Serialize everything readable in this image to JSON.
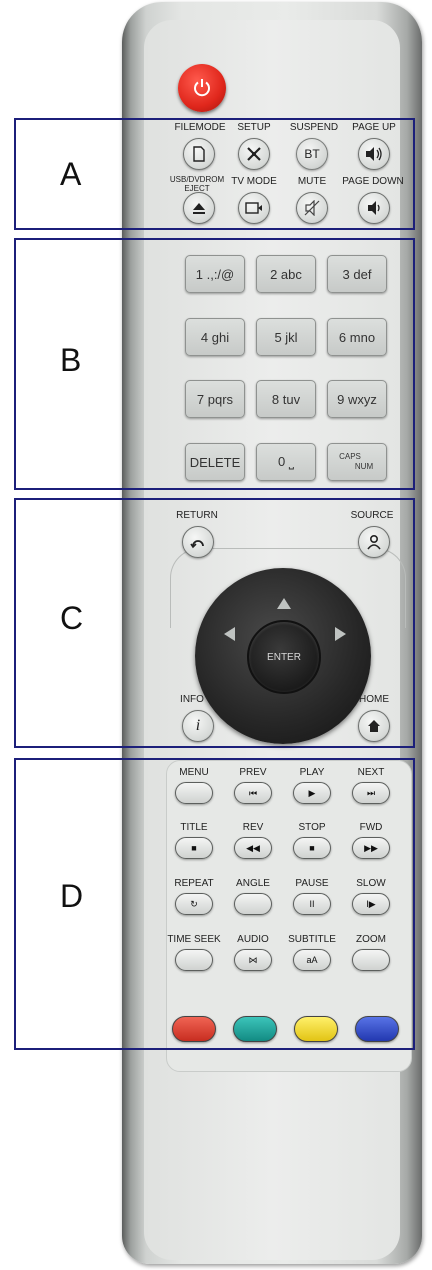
{
  "colors": {
    "frame": "#1c1f7a",
    "power_red": "#e0271c",
    "red_key": "#d93a2c",
    "green_key": "#19a39a",
    "yellow_key": "#f2d92a",
    "blue_key": "#2c49c7"
  },
  "sections": {
    "a": "A",
    "b": "B",
    "c": "C",
    "d": "D"
  },
  "power": {
    "icon": "power-icon"
  },
  "section_a": {
    "row1": [
      {
        "label": "FILEMODE",
        "icon": "file-icon"
      },
      {
        "label": "SETUP",
        "icon": "tools-icon"
      },
      {
        "label": "SUSPEND",
        "text": "BT"
      },
      {
        "label": "PAGE UP",
        "icon": "volume-up-icon"
      }
    ],
    "row2": [
      {
        "label": "USB/DVDROM EJECT",
        "icon": "eject-icon"
      },
      {
        "label": "TV MODE",
        "icon": "tv-mode-icon"
      },
      {
        "label": "MUTE",
        "icon": "mute-icon"
      },
      {
        "label": "PAGE DOWN",
        "icon": "volume-down-icon"
      }
    ]
  },
  "keypad": {
    "keys": [
      "1 .,:/@",
      "2 abc",
      "3 def",
      "4 ghi",
      "5 jkl",
      "6 mno",
      "7 pqrs",
      "8 tuv",
      "9 wxyz",
      "DELETE",
      "0 ⎵"
    ],
    "caps_top": "CAPS",
    "caps_bottom": "NUM"
  },
  "nav": {
    "return_label": "RETURN",
    "source_label": "SOURCE",
    "info_label": "INFO",
    "home_label": "HOME",
    "enter_label": "ENTER",
    "info_glyph": "i"
  },
  "playback": {
    "labels": [
      "MENU",
      "PREV",
      "PLAY",
      "NEXT",
      "TITLE",
      "REV",
      "STOP",
      "FWD",
      "REPEAT",
      "ANGLE",
      "PAUSE",
      "SLOW",
      "TIME SEEK",
      "AUDIO",
      "SUBTITLE",
      "ZOOM"
    ],
    "glyphs": [
      "",
      "⏮",
      "▶",
      "⏭",
      "■",
      "◀◀",
      "■",
      "▶▶",
      "↻",
      "",
      "II",
      "I▶",
      "",
      "⋈",
      "aA",
      ""
    ]
  }
}
